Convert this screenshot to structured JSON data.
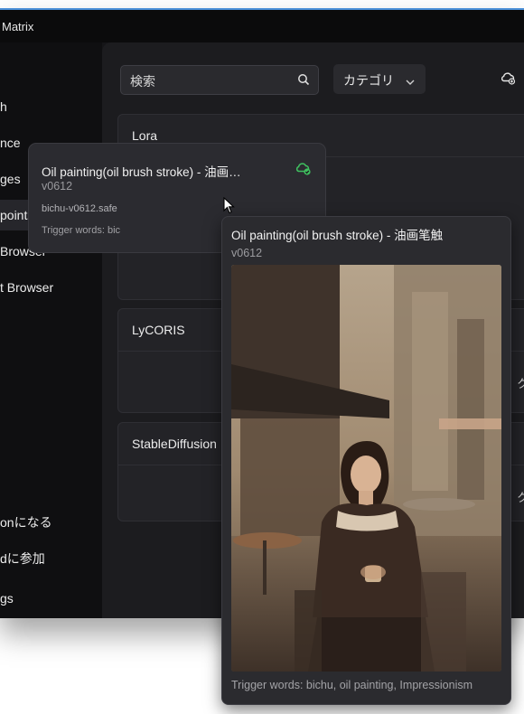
{
  "window": {
    "title": "Matrix"
  },
  "sidebar": {
    "items": [
      {
        "label": "h"
      },
      {
        "label": "nce"
      },
      {
        "label": "ges"
      },
      {
        "label": "points",
        "active": true
      },
      {
        "label": " Browser"
      },
      {
        "label": "t Browser"
      }
    ],
    "bottom_items": [
      {
        "label": "onになる"
      },
      {
        "label": "dに参加"
      },
      {
        "label": "gs"
      }
    ]
  },
  "toolbar": {
    "search_placeholder": "検索",
    "category_label": "カテゴリ"
  },
  "sections": [
    {
      "title": "Lora"
    },
    {
      "title": "LyCORIS",
      "side_text": "ク"
    },
    {
      "title": "StableDiffusion",
      "side_text": "ク"
    }
  ],
  "card": {
    "title": "Oil painting(oil brush stroke) - 油画…",
    "version": "v0612",
    "filename": "bichu-v0612.safe",
    "trigger_prefix": "Trigger words: bic"
  },
  "tooltip": {
    "title": "Oil painting(oil brush stroke) - 油画笔触",
    "version": "v0612",
    "trigger_words": "Trigger words: bichu, oil painting, Impressionism"
  },
  "colors": {
    "accent_blue": "#4a8fd8",
    "cloud_green": "#3fbf5f",
    "background": "#1c1c1f"
  }
}
